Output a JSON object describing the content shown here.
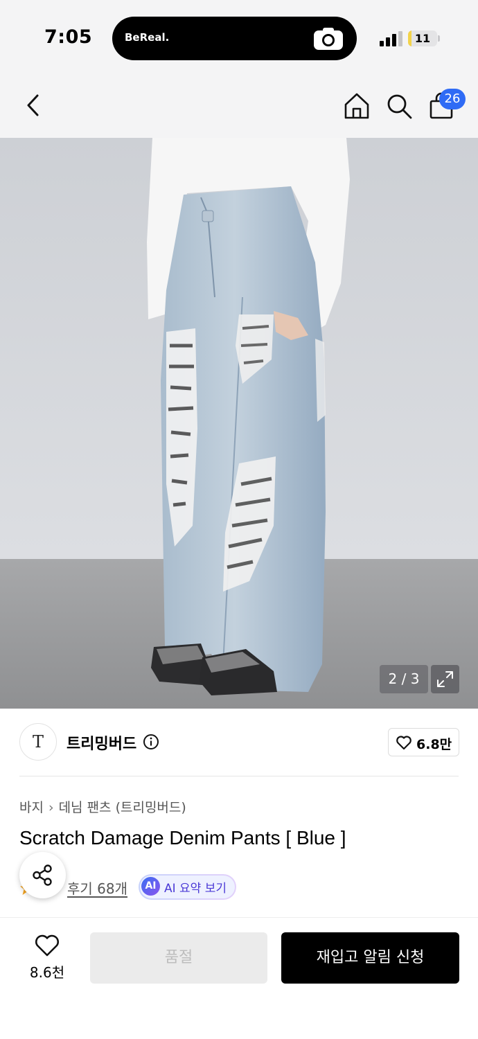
{
  "status_bar": {
    "time": "7:05",
    "island_label": "BeReal.",
    "battery_level": "11",
    "battery_fraction": 0.11
  },
  "nav": {
    "cart_badge": "26",
    "icons": [
      "chevron-left-icon",
      "home-icon",
      "search-icon",
      "shopping-bag-icon"
    ]
  },
  "gallery": {
    "counter": "2 / 3"
  },
  "seller": {
    "logo_text": "T",
    "brand_name": "트리밍버드",
    "like_count": "6.8만"
  },
  "breadcrumb": {
    "level1": "바지",
    "level2": "데님 팬츠 (트리밍버드)"
  },
  "product": {
    "title": "Scratch Damage Denim Pants [ Blue ]",
    "review_link": "후기 68개",
    "ai_badge": "AI",
    "ai_summary_label": "AI 요약 보기"
  },
  "bottom_bar": {
    "fav_count": "8.6천",
    "soldout_label": "품절",
    "restock_label": "재입고 알림 신청"
  },
  "colors": {
    "accent": "#2f6bf5",
    "primary_button": "#000000",
    "disabled_button": "#ebebeb",
    "ai_text": "#4b3ad6"
  }
}
